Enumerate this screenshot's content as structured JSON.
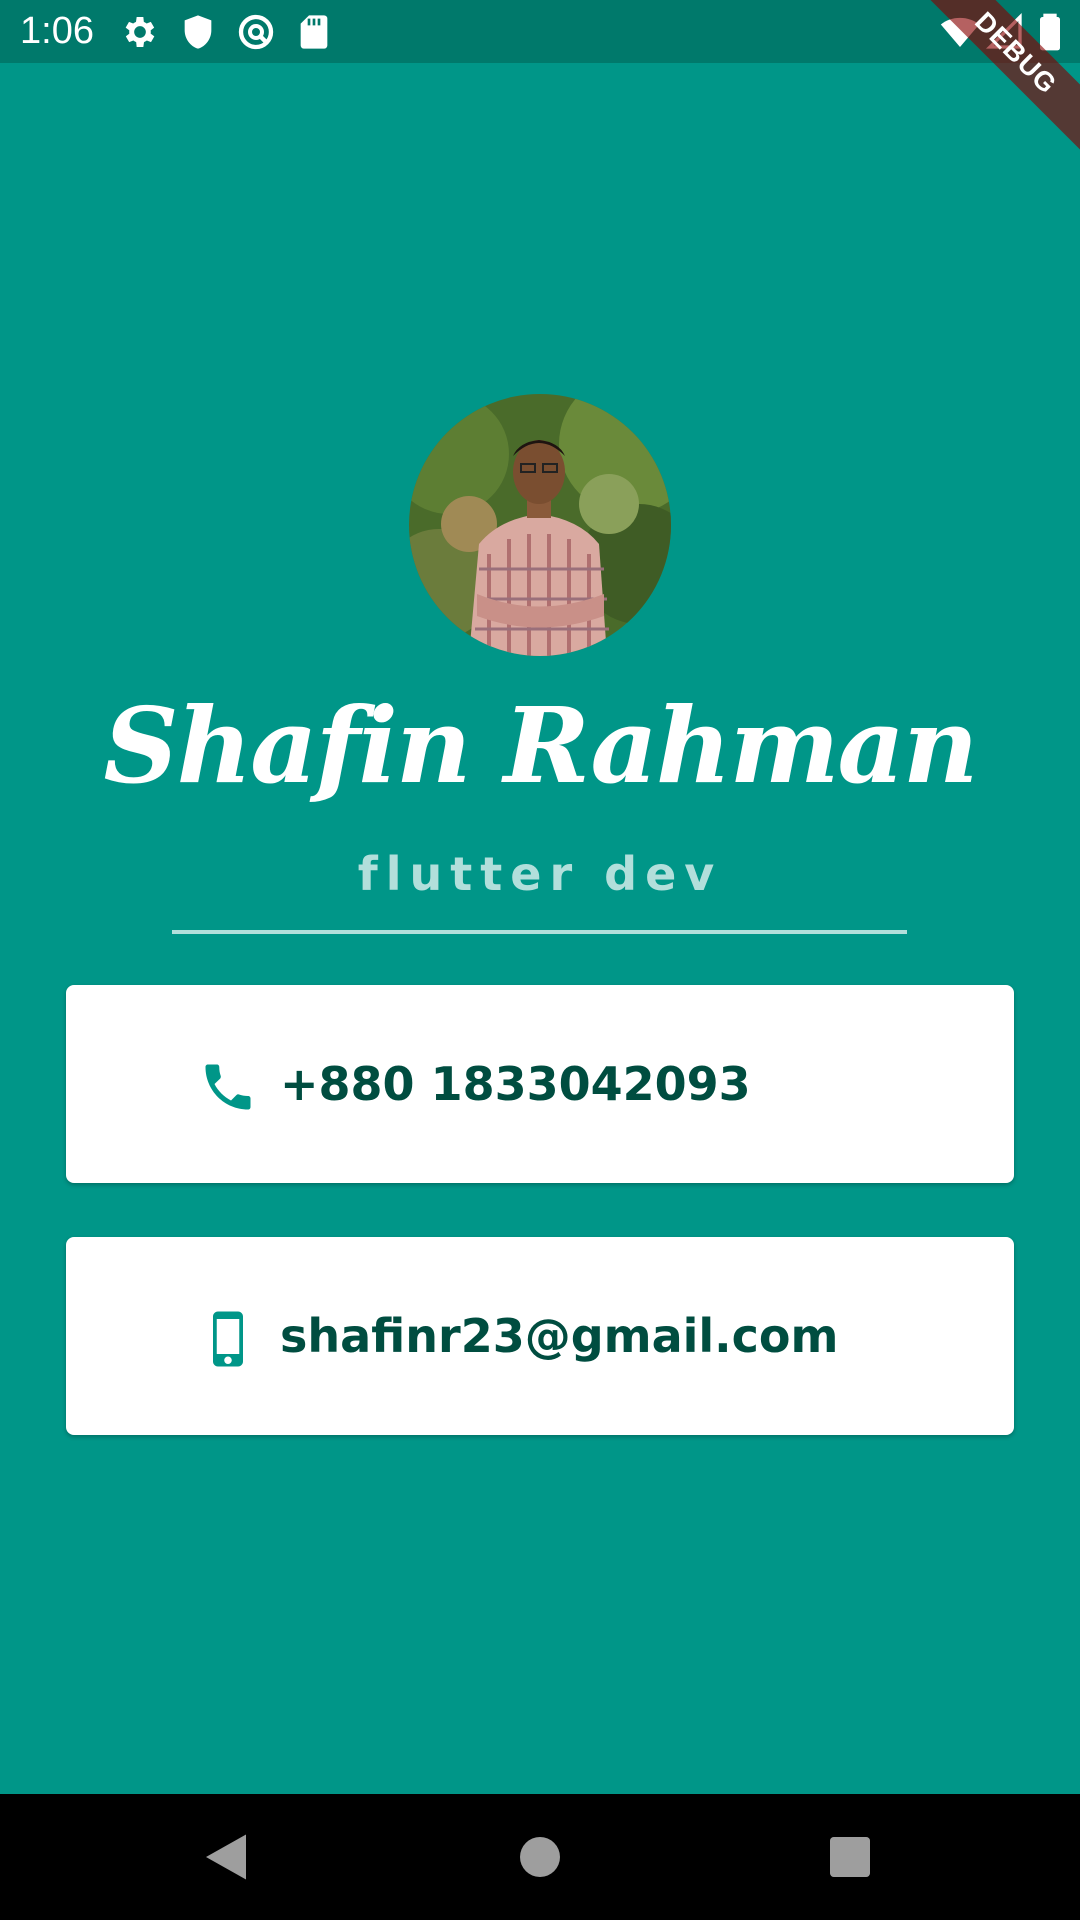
{
  "status_bar": {
    "time": "1:06",
    "icons": [
      "gear-icon",
      "shield-icon",
      "circle-a-icon",
      "sd-card-icon",
      "wifi-icon",
      "signal-icon",
      "battery-icon"
    ]
  },
  "debug_banner": {
    "label": "DEBUG"
  },
  "profile": {
    "name": "Shafin Rahman",
    "subtitle": "flutter dev",
    "avatar_icon": "profile-photo"
  },
  "cards": [
    {
      "icon": "phone-icon",
      "text": "+880 1833042093"
    },
    {
      "icon": "smartphone-icon",
      "text": "shafinr23@gmail.com"
    }
  ],
  "nav_bar": {
    "buttons": [
      "back-icon",
      "home-icon",
      "recents-icon"
    ]
  },
  "colors": {
    "background": "#009688",
    "status_bar": "#00796b",
    "accent_text": "#004d40",
    "subtitle": "#b2dfdb",
    "card": "#ffffff"
  }
}
